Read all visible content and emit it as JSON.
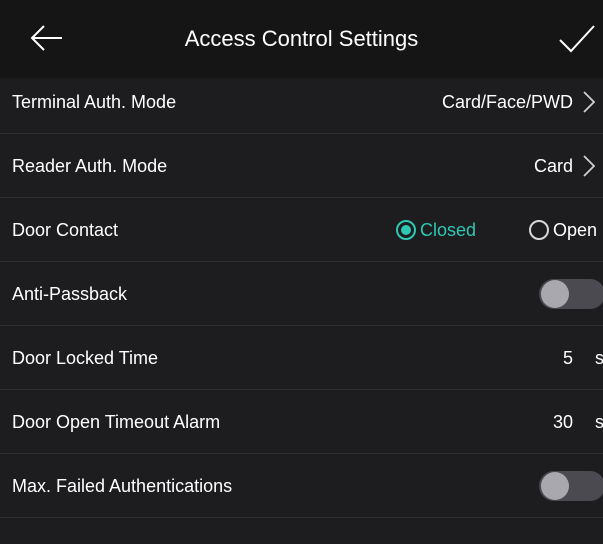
{
  "header": {
    "title": "Access Control Settings",
    "back_icon": "arrow-left-icon",
    "confirm_icon": "checkmark-icon"
  },
  "rows": {
    "terminal_auth": {
      "label": "Terminal Auth. Mode",
      "value": "Card/Face/PWD"
    },
    "reader_auth": {
      "label": "Reader Auth. Mode",
      "value": "Card"
    },
    "door_contact": {
      "label": "Door Contact",
      "options": [
        "Closed",
        "Open"
      ],
      "selected": "Closed"
    },
    "anti_passback": {
      "label": "Anti-Passback",
      "enabled": false
    },
    "door_locked_time": {
      "label": "Door Locked Time",
      "value": "5",
      "unit": "s"
    },
    "door_open_timeout": {
      "label": "Door Open Timeout Alarm",
      "value": "30",
      "unit": "s"
    },
    "max_failed_auth": {
      "label": "Max. Failed Authentications",
      "enabled": false
    }
  },
  "colors": {
    "accent": "#2fc7b4",
    "background": "#1d1d1f",
    "header_bg": "#151516"
  }
}
